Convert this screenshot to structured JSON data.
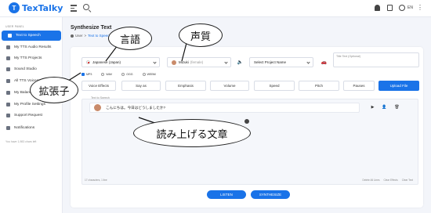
{
  "app": {
    "logo_mark": "T",
    "logo_text": "TexTalky"
  },
  "header": {
    "lang": "EN",
    "user_menu": "⋮"
  },
  "sidebar": {
    "heading": "USER PANEL",
    "items": [
      {
        "label": "Text to Speech"
      },
      {
        "label": "My TTS Audio Results"
      },
      {
        "label": "My TTS Projects"
      },
      {
        "label": "Sound Studio"
      },
      {
        "label": "All TTS Voices"
      },
      {
        "label": "My Balance"
      },
      {
        "label": "My Profile Settings"
      },
      {
        "label": "Support Request"
      },
      {
        "label": "Notifications"
      }
    ],
    "footer": "You have 1,983 chars left"
  },
  "main": {
    "title": "Synthesize Text",
    "breadcrumb": {
      "user": "User",
      "current": "Text to Speech"
    },
    "language": {
      "value": "Japanese (Japan)"
    },
    "voice": {
      "value": "Mizuki",
      "sub": "(female)"
    },
    "project": {
      "value": "Select Project Name"
    },
    "title_field": {
      "placeholder": "Title Text (Optional)"
    },
    "formats": [
      "MP3",
      "WAV",
      "OGG",
      "WEBM"
    ],
    "toolbar": [
      "Voice Effects",
      "Say as",
      "Emphasis",
      "Volume",
      "Speed",
      "Pitch",
      "Pauses",
      "Upload File"
    ],
    "text_label": "Text to Speech",
    "line_text": "こんにちは。今日はどうしましたか?",
    "counter": "17 characters, 1 line",
    "editor_links": [
      "Delete All Lines",
      "Clear Effects",
      "Clear Text"
    ],
    "listen": "LISTEN",
    "synthesize": "SYNTHESIZE"
  },
  "annotations": {
    "language": "言語",
    "voice": "声質",
    "extension": "拡張子",
    "text": "読み上げる文章"
  },
  "colors": {
    "accent": "#1a73e8"
  }
}
